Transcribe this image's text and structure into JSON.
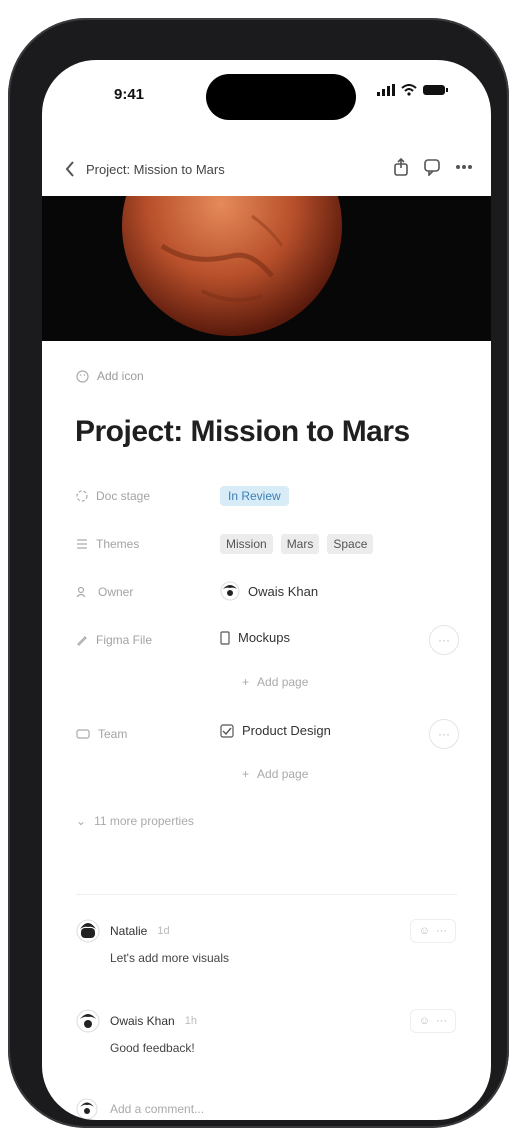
{
  "status_bar": {
    "time": "9:41"
  },
  "nav": {
    "title": "Project: Mission to Mars"
  },
  "page": {
    "add_icon_label": "Add icon",
    "title": "Project: Mission to Mars"
  },
  "properties": [
    {
      "icon": "status-icon",
      "label": "Doc stage",
      "value": "In Review"
    },
    {
      "icon": "list-icon",
      "label": "Themes",
      "values": [
        "Mission",
        "Mars",
        "Space"
      ]
    },
    {
      "icon": "people-icon",
      "label": "Owner",
      "value": "Owais Khan"
    },
    {
      "icon": "pencil-icon",
      "label": "Figma File",
      "value": "Mockups",
      "add_page": "Add page"
    },
    {
      "icon": "team-icon",
      "label": "Team",
      "value": "Product Design",
      "add_page": "Add page"
    }
  ],
  "more_properties": "11 more properties",
  "comments": [
    {
      "author": "Natalie",
      "time": "1d",
      "text": "Let's add more visuals"
    },
    {
      "author": "Owais Khan",
      "time": "1h",
      "text": "Good feedback!"
    }
  ],
  "add_comment_placeholder": "Add a comment..."
}
